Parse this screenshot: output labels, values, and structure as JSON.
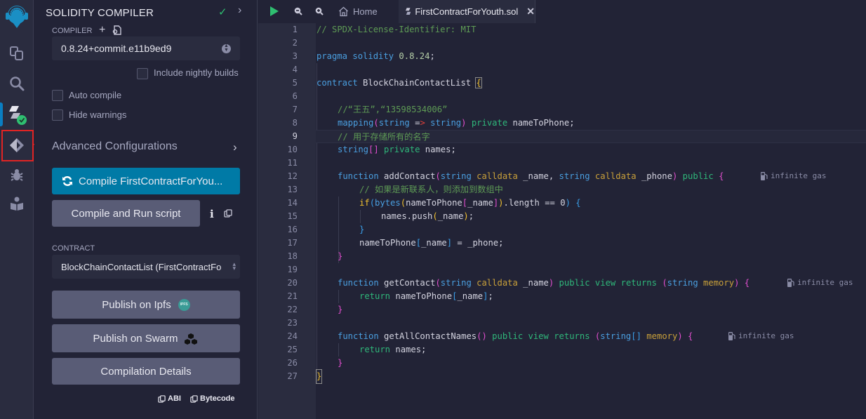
{
  "iconbar": {
    "items": [
      {
        "name": "remix-logo-icon"
      },
      {
        "name": "file-explorer-icon"
      },
      {
        "name": "search-icon"
      },
      {
        "name": "solidity-compiler-icon",
        "active": true,
        "badge": "check"
      },
      {
        "name": "deploy-run-icon",
        "highlighted": true
      },
      {
        "name": "debugger-icon"
      },
      {
        "name": "learneth-icon"
      }
    ]
  },
  "panel": {
    "title": "SOLIDITY COMPILER",
    "compiler_label": "COMPILER",
    "compiler_version": "0.8.24+commit.e11b9ed9",
    "include_nightly_label": "Include nightly builds",
    "auto_compile_label": "Auto compile",
    "hide_warnings_label": "Hide warnings",
    "advanced_label": "Advanced Configurations",
    "compile_button": "Compile FirstContractForYou...",
    "compile_run_button": "Compile and Run script",
    "info_glyph": "i",
    "contract_label": "CONTRACT",
    "contract_selected": "BlockChainContactList (FirstContractFo",
    "publish_ipfs": "Publish on Ipfs",
    "ipfs_badge": "IPFS",
    "publish_swarm": "Publish on Swarm",
    "compilation_details": "Compilation Details",
    "abi_label": "ABI",
    "bytecode_label": "Bytecode"
  },
  "editor": {
    "tabs": [
      {
        "label": "Home",
        "icon": "home-icon"
      },
      {
        "label": "FirstContractForYouth.sol",
        "icon": "solidity-file-icon",
        "active": true
      }
    ],
    "close_glyph": "✕",
    "active_line": 9,
    "gas_label": "infinite gas",
    "lines": [
      "1",
      "2",
      "3",
      "4",
      "5",
      "6",
      "7",
      "8",
      "9",
      "10",
      "11",
      "12",
      "13",
      "14",
      "15",
      "16",
      "17",
      "18",
      "19",
      "20",
      "21",
      "22",
      "23",
      "24",
      "25",
      "26",
      "27"
    ],
    "code": {
      "l1": "// SPDX-License-Identifier: MIT",
      "l3_kw": "pragma solidity",
      "l3_num": " 0.8.24",
      "l3_end": ";",
      "l5_kw": "contract",
      "l5_id": " BlockChainContactList ",
      "l7": "//“王五”,“13598534006”",
      "l8_a": "mapping",
      "l8_b": "string",
      "l8_c": " =",
      "l8_d": ">",
      "l8_e": " string",
      "l8_f": " private",
      "l8_g": " nameToPhone;",
      "l9": "// 用于存储所有的名字",
      "l10_a": "string",
      "l10_b": " private",
      "l10_c": " names;",
      "l12_fn": "function",
      "l12_name": " addContact",
      "l12_str": "string",
      "l12_cd": " calldata",
      "l12_p1": " _name, ",
      "l12_str2": "string",
      "l12_cd2": " calldata",
      "l12_p2": " _phone",
      "l12_pub": " public",
      "l13": "// 如果是新联系人，则添加到数组中",
      "l14_if": "if",
      "l14_bytes": "bytes",
      "l14_a": "nameToPhone",
      "l14_b": "_name",
      "l14_c": ".length == 0",
      "l15": "names.push",
      "l15_arg": "_name",
      "l17_a": "nameToPhone",
      "l17_b": "_name",
      "l17_c": " = _phone;",
      "l20_fn": "function",
      "l20_name": " getContact",
      "l20_str": "string",
      "l20_cd": " calldata",
      "l20_p": " _name",
      "l20_mods": " public view returns ",
      "l20_ret": "string",
      "l20_mem": " memory",
      "l21_ret": "return",
      "l21_a": " nameToPhone",
      "l21_b": "_name",
      "l24_fn": "function",
      "l24_name": " getAllContactNames",
      "l24_mods": " public view returns ",
      "l24_ret": "string",
      "l24_mem": " memory",
      "l25_ret": "return",
      "l25_a": " names;"
    }
  }
}
